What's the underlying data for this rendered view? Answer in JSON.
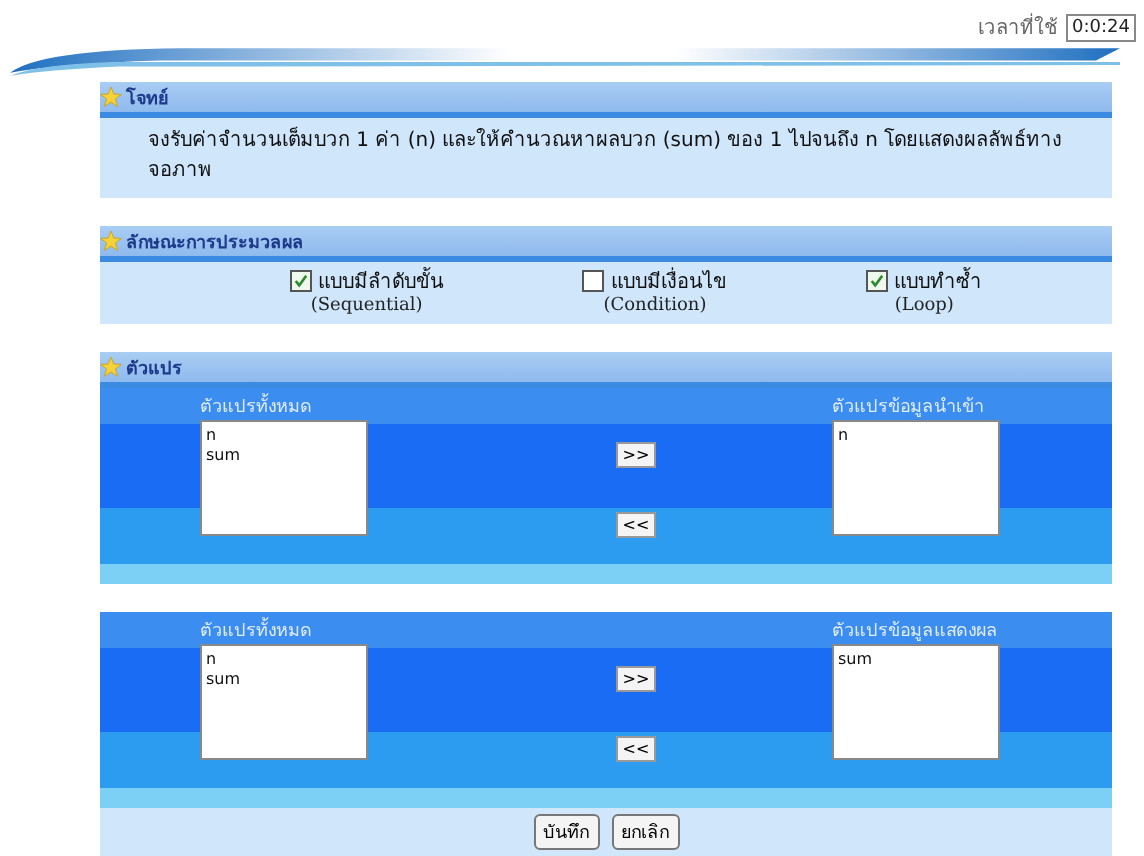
{
  "timer": {
    "label": "เวลาที่ใช้",
    "value": "0:0:24"
  },
  "problem": {
    "title": "โจทย์",
    "text": "จงรับค่าจำนวนเต็มบวก 1 ค่า (n) และให้คำนวณหาผลบวก (sum) ของ 1 ไปจนถึง n โดยแสดงผลลัพธ์ทางจอภาพ"
  },
  "processing": {
    "title": "ลักษณะการประมวลผล",
    "options": [
      {
        "label": "แบบมีลำดับขั้น",
        "sub": "(Sequential)",
        "checked": true
      },
      {
        "label": "แบบมีเงื่อนไข",
        "sub": "(Condition)",
        "checked": false
      },
      {
        "label": "แบบทำซ้ำ",
        "sub": "(Loop)",
        "checked": true
      }
    ]
  },
  "variables": {
    "title": "ตัวแปร",
    "panels": [
      {
        "left_label": "ตัวแปรทั้งหมด",
        "left_items": [
          "n",
          "sum"
        ],
        "add": ">>",
        "remove": "<<",
        "right_label": "ตัวแปรข้อมูลนำเข้า",
        "right_items": [
          "n"
        ]
      },
      {
        "left_label": "ตัวแปรทั้งหมด",
        "left_items": [
          "n",
          "sum"
        ],
        "add": ">>",
        "remove": "<<",
        "right_label": "ตัวแปรข้อมูลแสดงผล",
        "right_items": [
          "sum"
        ]
      }
    ]
  },
  "buttons": [
    "บันทึก",
    "ยกเลิก"
  ]
}
